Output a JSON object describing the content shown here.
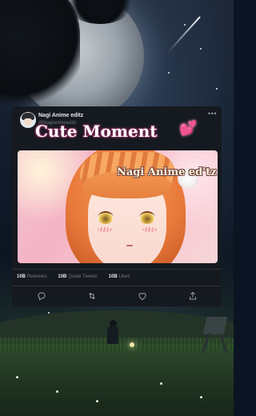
{
  "post": {
    "user_name": "Nagi Anime editz",
    "user_handle": "@Nagianimeeditz",
    "headline": "Cute Moment",
    "image_watermark": "Nagi Anime ed'tz",
    "stats": [
      {
        "value": "10B",
        "label": "Retweets"
      },
      {
        "value": "10B",
        "label": "Quote Tweets"
      },
      {
        "value": "10B",
        "label": "Likes"
      }
    ],
    "more_icon": "more-horizontal-icon",
    "headline_icon": "heart-icon",
    "actions": [
      {
        "icon": "reply-icon"
      },
      {
        "icon": "retweet-icon"
      },
      {
        "icon": "like-icon"
      },
      {
        "icon": "share-icon"
      }
    ]
  },
  "colors": {
    "card_background": "#151a20",
    "primary_text": "#e7e9ea",
    "secondary_text": "#71767b",
    "heart": "#f062a6"
  }
}
